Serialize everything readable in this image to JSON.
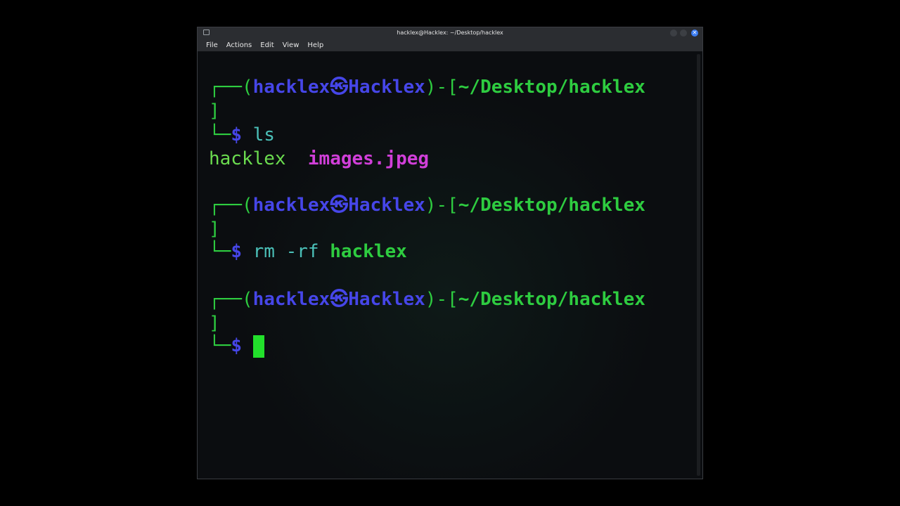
{
  "window": {
    "title": "hacklex@Hacklex: ~/Desktop/hacklex",
    "close_glyph": "✕"
  },
  "menu": {
    "items": [
      "File",
      "Actions",
      "Edit",
      "View",
      "Help"
    ]
  },
  "prompt": {
    "open_corner": "┌──(",
    "user": "hacklex",
    "at_glyph": "㉿",
    "host": "Hacklex",
    "close_paren": ")-[",
    "path": "~/Desktop/hacklex",
    "bracket_close": "]",
    "bottom_corner": "└─",
    "dollar": "$"
  },
  "commands": [
    {
      "cmd": "ls",
      "args": ""
    },
    {
      "cmd": "rm",
      "args": "-rf",
      "target": "hacklex"
    }
  ],
  "output": {
    "dir": "hacklex",
    "file": "images.jpeg"
  },
  "colors": {
    "background": "#0b0d10",
    "prompt_green": "#2ecc40",
    "user_blue": "#4646e8",
    "file_magenta": "#d13fd9",
    "cursor_green": "#22e02b"
  }
}
